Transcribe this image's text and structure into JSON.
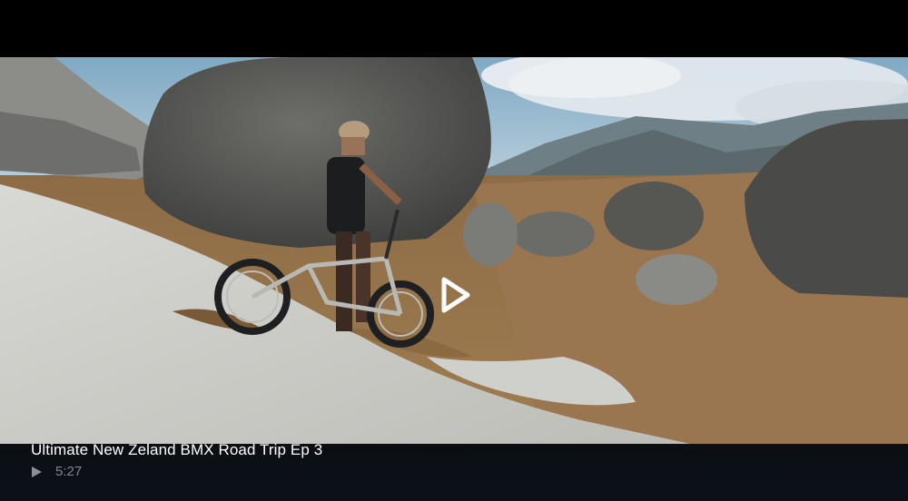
{
  "video": {
    "title": "Ultimate New Zeland BMX Road Trip Ep 3",
    "duration": "5:27",
    "thumbnail_scene": "rider-with-bmx-on-rocky-hillside"
  },
  "icons": {
    "center_play": "play-icon",
    "small_play": "play-icon"
  },
  "colors": {
    "background": "#000000",
    "title_text": "#ffffff",
    "duration_text": "#7f8790",
    "play_icon": "#ffffff",
    "small_play_icon": "#8a9098"
  }
}
